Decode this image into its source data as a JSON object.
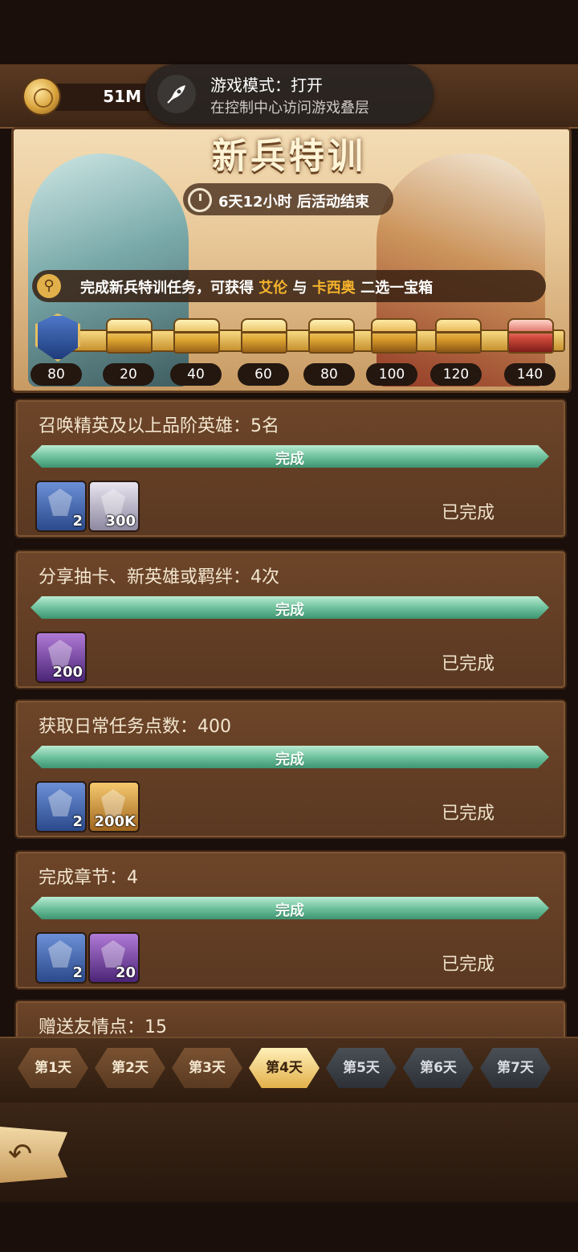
{
  "currency": {
    "amount": "51M",
    "icon": "gold-coin-icon"
  },
  "overlay": {
    "title": "游戏模式：打开",
    "subtitle": "在控制中心访问游戏叠层",
    "icon": "rocket-icon"
  },
  "event": {
    "title": "新兵特训",
    "timer": "6天12小时 后活动结束",
    "desc_prefix": "完成新兵特训任务，可获得 ",
    "hero1": "艾伦",
    "desc_mid": " 与 ",
    "hero2": "卡西奥",
    "desc_suffix": " 二选一宝箱"
  },
  "milestones": [
    {
      "label": "80",
      "type": "shield"
    },
    {
      "label": "20",
      "type": "open-chest"
    },
    {
      "label": "40",
      "type": "open-chest"
    },
    {
      "label": "60",
      "type": "open-chest"
    },
    {
      "label": "80",
      "type": "open-chest"
    },
    {
      "label": "100",
      "type": "gold-chest"
    },
    {
      "label": "120",
      "type": "gold-chest"
    },
    {
      "label": "140",
      "type": "red-chest"
    }
  ],
  "tasks": [
    {
      "title": "召唤精英及以上品阶英雄：5名",
      "progress": "完成",
      "status": "已完成",
      "rewards": [
        {
          "count": "2",
          "icon": "emblem-icon"
        },
        {
          "count": "300",
          "icon": "diamond-icon"
        }
      ]
    },
    {
      "title": "分享抽卡、新英雄或羁绊：4次",
      "progress": "完成",
      "status": "已完成",
      "rewards": [
        {
          "count": "200",
          "icon": "crystal-dust-icon"
        }
      ]
    },
    {
      "title": "获取日常任务点数：400",
      "progress": "完成",
      "status": "已完成",
      "rewards": [
        {
          "count": "2",
          "icon": "emblem-icon"
        },
        {
          "count": "200K",
          "icon": "gold-coin-icon"
        }
      ]
    },
    {
      "title": "完成章节：4",
      "progress": "完成",
      "status": "已完成",
      "rewards": [
        {
          "count": "2",
          "icon": "emblem-icon"
        },
        {
          "count": "20",
          "icon": "soulstone-icon"
        }
      ]
    },
    {
      "title": "赠送友情点：15"
    }
  ],
  "days": [
    "第1天",
    "第2天",
    "第3天",
    "第4天",
    "第5天",
    "第6天",
    "第7天"
  ],
  "back": {
    "icon": "back-arrow-icon",
    "symbol": "↶"
  }
}
